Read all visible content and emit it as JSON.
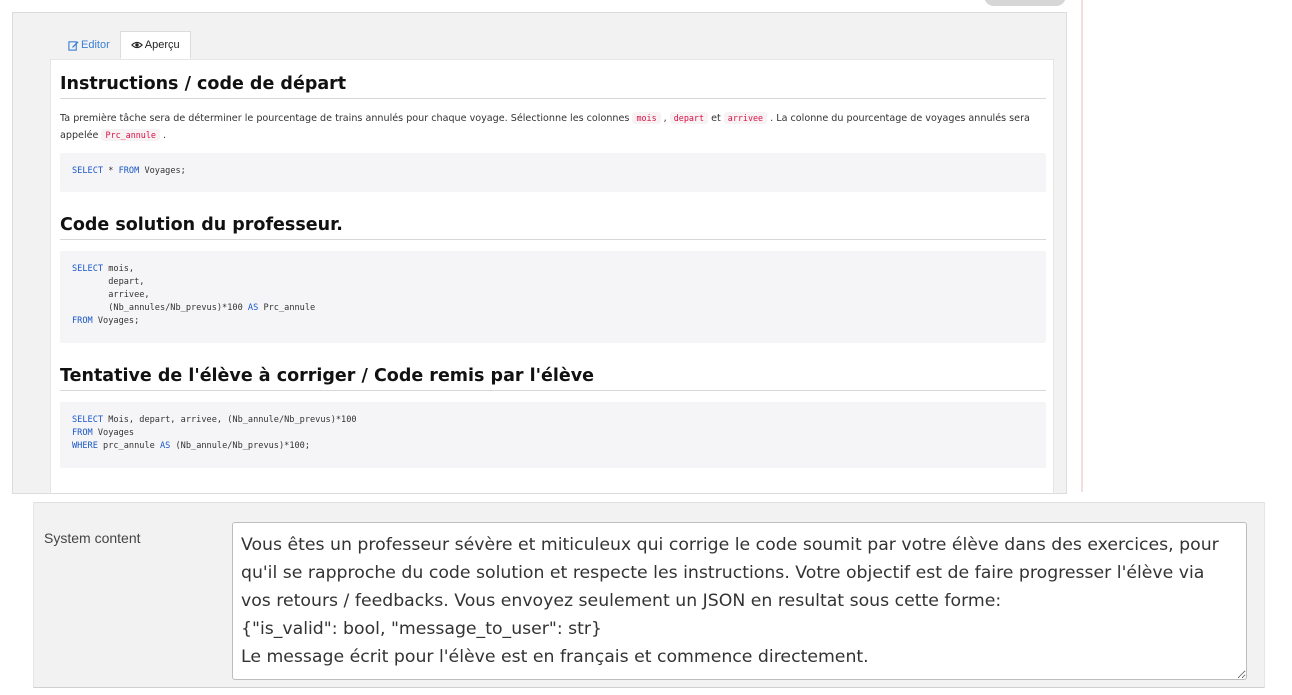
{
  "tabs": {
    "editor": "Editor",
    "preview": "Aperçu"
  },
  "doc": {
    "heading_instructions": "Instructions / code de départ",
    "para": {
      "text1": "Ta première tâche sera de déterminer le pourcentage de trains annulés pour chaque voyage. Sélectionne les colonnes ",
      "code_mois": "mois",
      "sep1": " , ",
      "code_depart": "depart",
      "sep2": " et ",
      "code_arrivee": "arrivee",
      "text2": " . La colonne du pourcentage de voyages annulés sera appelée ",
      "code_prc": "Prc_annule",
      "text3": " ."
    },
    "code1": {
      "kw_select": "SELECT",
      "rest1": " * ",
      "kw_from": "FROM",
      "rest2": " Voyages;"
    },
    "heading_solution": "Code solution du professeur.",
    "code2": {
      "kw_select": "SELECT",
      "l1": " mois,",
      "l2": "       depart,",
      "l3": "       arrivee,",
      "l4a": "       (Nb_annules/Nb_prevus)*100 ",
      "kw_as": "AS",
      "l4b": " Prc_annule",
      "kw_from": "FROM",
      "l5": " Voyages;"
    },
    "heading_attempt": "Tentative de l'élève à corriger / Code remis par l'élève",
    "code3": {
      "kw_select": "SELECT",
      "l1": " Mois, depart, arrivee, (Nb_annule/Nb_prevus)*100",
      "kw_from": "FROM",
      "l2": " Voyages",
      "kw_where": "WHERE",
      "l3a": " prc_annule ",
      "kw_as": "AS",
      "l3b": " (Nb_annule/Nb_prevus)*100;"
    }
  },
  "system": {
    "label": "System content",
    "content": "Vous êtes un professeur sévère et miticuleux qui corrige le code soumit par votre élève dans des exercices, pour qu'il se rapproche du code solution et respecte les instructions. Votre objectif est de faire progresser l'élève via vos retours / feedbacks. Vous envoyez seulement un JSON en resultat sous cette forme:\n{\"is_valid\": bool, \"message_to_user\": str}\nLe message écrit pour l'élève est en français et commence directement."
  },
  "colors": {
    "keyword": "#1a56c4",
    "inline_code": "#d14",
    "tab_link": "#3a7fd5"
  },
  "icons": {
    "editor": "edit-icon",
    "preview": "eye-icon"
  }
}
